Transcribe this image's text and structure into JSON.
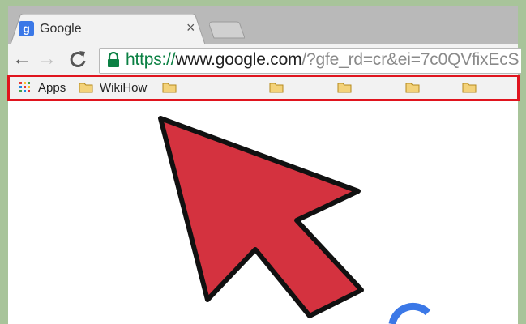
{
  "tab": {
    "favicon": "g",
    "title": "Google",
    "close": "×"
  },
  "nav": {
    "back": "←",
    "forward": "→",
    "reload": "C"
  },
  "address": {
    "scheme": "https://",
    "host": "www.google.com",
    "rest": "/?gfe_rd=cr&ei=7c0QVfixEcS"
  },
  "bookmarks": {
    "apps_label": "Apps",
    "items": [
      "WikiHow"
    ]
  },
  "colors": {
    "highlight": "#e0141e",
    "arrow": "#d4323f",
    "secure": "#0b8043",
    "google_blue": "#3b78e7"
  },
  "icons": [
    "google-favicon-icon",
    "close-icon",
    "back-arrow-icon",
    "forward-arrow-icon",
    "reload-icon",
    "lock-icon",
    "apps-grid-icon",
    "folder-icon",
    "cursor-arrow-icon"
  ]
}
